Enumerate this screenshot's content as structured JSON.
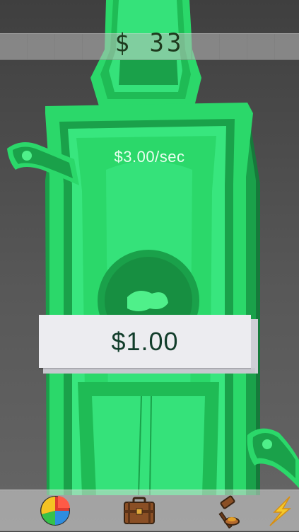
{
  "header": {
    "total_money": "$ 33"
  },
  "main": {
    "rate": "$3.00/sec",
    "click_value": "$1.00"
  },
  "colors": {
    "bill_main": "#2bd86a",
    "bill_dark": "#1aa14a",
    "bill_light": "#4ff08a",
    "panel": "#ececf0",
    "text_dark": "#123d2b"
  },
  "bottom_nav": [
    {
      "icon": "pie-chart-icon"
    },
    {
      "icon": "briefcase-icon"
    },
    {
      "icon": "gavel-icon"
    },
    {
      "icon": "lightning-icon"
    }
  ]
}
